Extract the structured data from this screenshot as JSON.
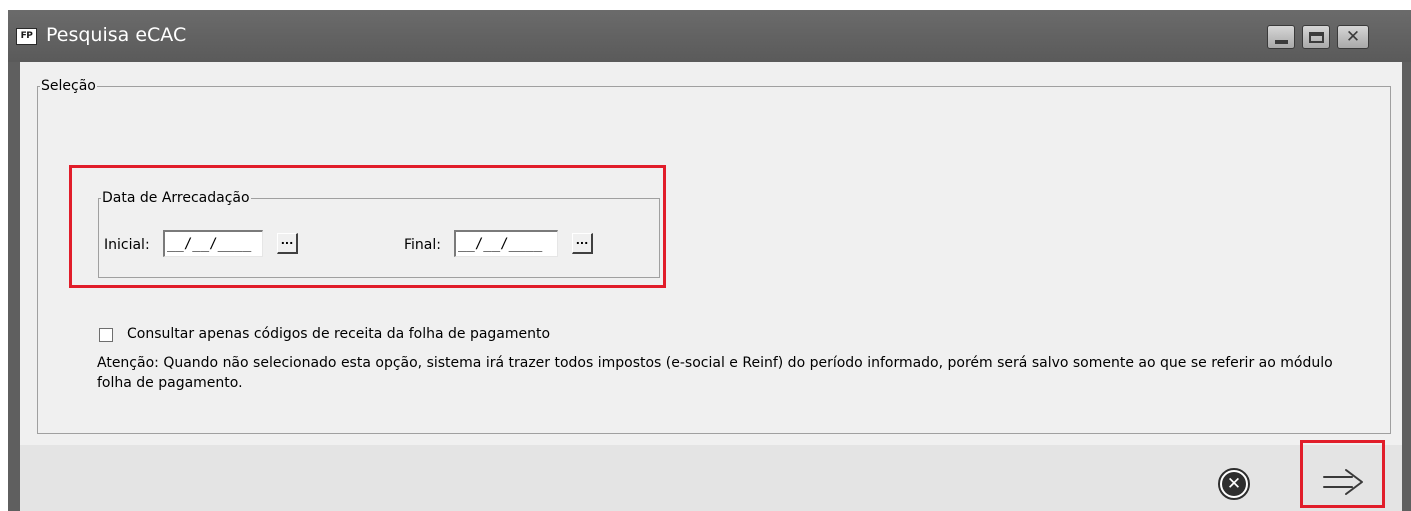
{
  "window": {
    "app_icon_text": "FP",
    "title": "Pesquisa eCAC",
    "controls": {
      "minimize": "minimize-icon",
      "maximize": "maximize-icon",
      "close": "close-icon"
    }
  },
  "selection": {
    "legend": "Seleção",
    "date_group": {
      "legend": "Data de Arrecadação",
      "start_label": "Inicial:",
      "start_value": "__/__/____",
      "end_label": "Final:",
      "end_value": "__/__/____",
      "picker_button_label": "..."
    },
    "checkbox_label": "Consultar apenas códigos de receita da folha de pagamento",
    "checkbox_checked": false,
    "note": "Atenção: Quando não selecionado esta opção, sistema irá trazer todos impostos (e-social e Reinf) do período informado, porém será salvo somente ao que se referir ao módulo folha de pagamento."
  },
  "footer": {
    "cancel_icon": "cancel-circle-icon",
    "next_icon": "arrow-right-icon"
  },
  "colors": {
    "highlight": "#e11d2a",
    "titlebar": "#5f5f5f",
    "panel": "#f0f0f0"
  }
}
